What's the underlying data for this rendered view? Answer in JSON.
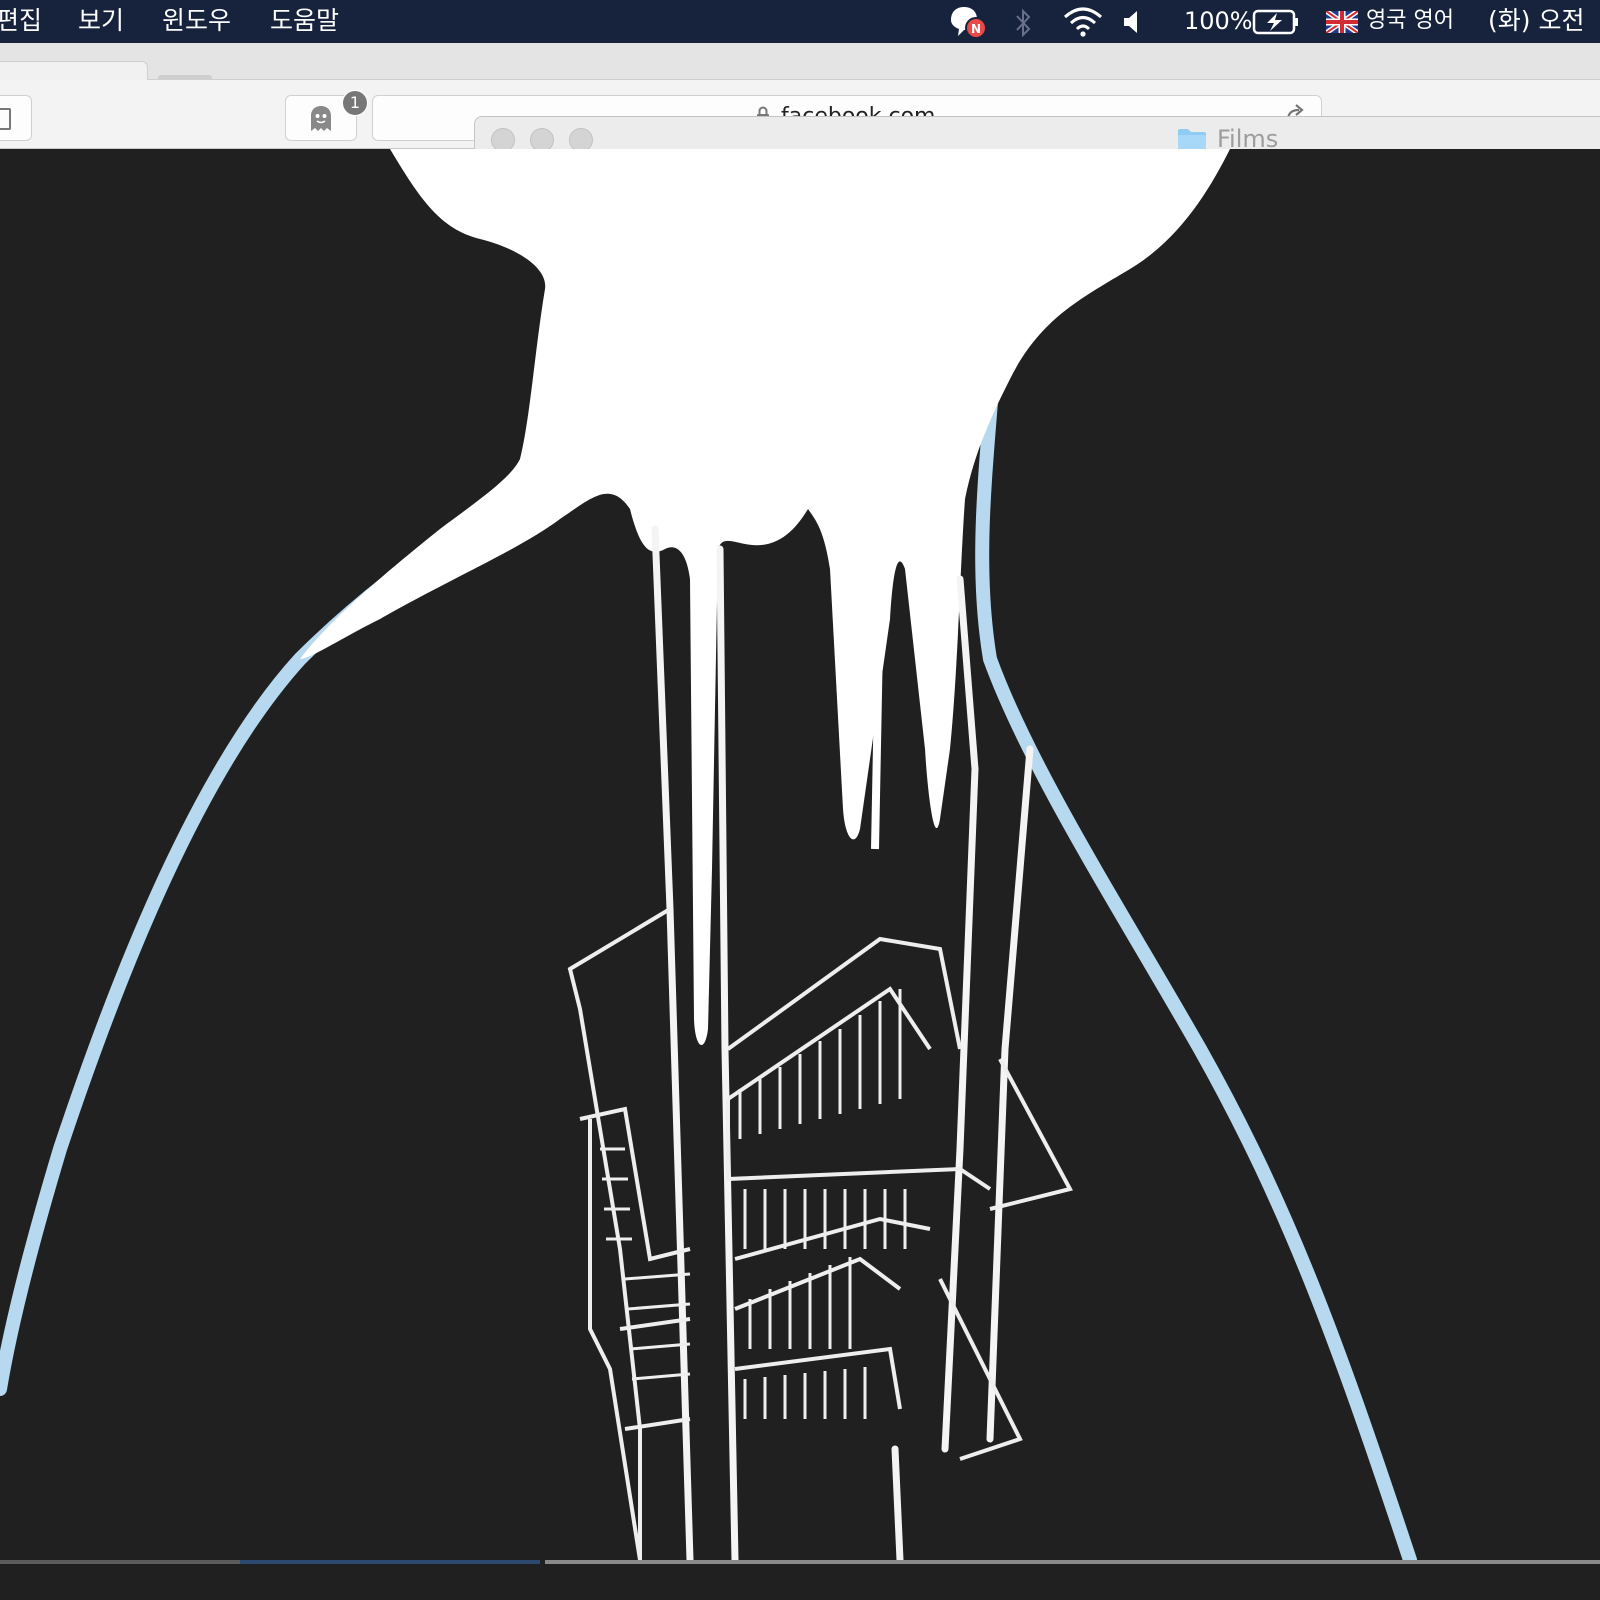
{
  "menubar": {
    "items": [
      "편집",
      "보기",
      "윈도우",
      "도움말"
    ],
    "status": {
      "battery_percent": "100%",
      "input_language": "영국 영어",
      "clock_prefix": "(화) 오전"
    },
    "icons": [
      "messenger-icon",
      "bluetooth-icon",
      "wifi-icon",
      "volume-icon",
      "battery-icon",
      "uk-flag-icon"
    ],
    "colors": {
      "bar": "#17223d",
      "notification_badge": "#e84a4a"
    }
  },
  "browser": {
    "extension_badge": "1",
    "address": "facebook.com"
  },
  "finder": {
    "title": "Films"
  },
  "artwork": {
    "colors": {
      "background": "#202020",
      "splash": "#ffffff",
      "outline": "#b6d9f0",
      "lines": "#f4f4f4"
    }
  }
}
